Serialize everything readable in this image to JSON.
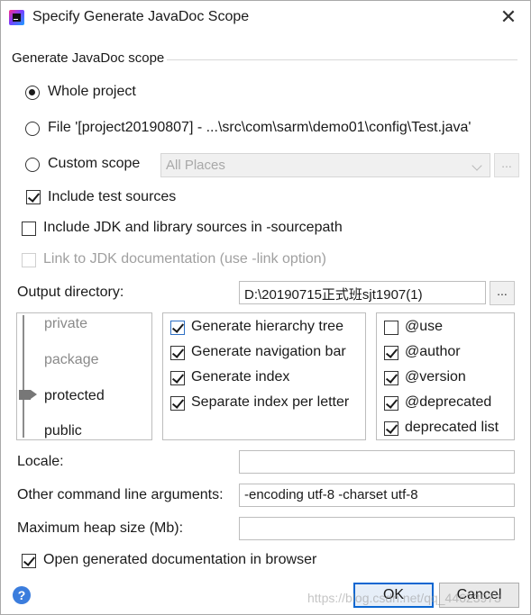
{
  "window": {
    "title": "Specify Generate JavaDoc Scope",
    "close_glyph": "✕"
  },
  "scope": {
    "section_label": "Generate JavaDoc scope",
    "whole_project_label": "Whole project",
    "file_label": "File '[project20190807] - ...\\src\\com\\sarm\\demo01\\config\\Test.java'",
    "custom_scope_label": "Custom scope",
    "custom_scope_value": "All Places",
    "custom_scope_dots": "...",
    "include_test_sources_label": "Include test sources",
    "selected": "whole_project"
  },
  "options": {
    "include_jdk_label": "Include JDK and library sources in -sourcepath",
    "link_jdk_label": "Link to JDK documentation (use -link option)"
  },
  "output": {
    "label": "Output directory:",
    "value": "D:\\20190715正式班sjt1907(1)",
    "browse_label": "..."
  },
  "visibility": {
    "levels": [
      "private",
      "package",
      "protected",
      "public"
    ],
    "selected": "protected"
  },
  "generate": {
    "items": [
      {
        "label": "Generate hierarchy tree",
        "checked": true
      },
      {
        "label": "Generate navigation bar",
        "checked": true
      },
      {
        "label": "Generate index",
        "checked": true
      },
      {
        "label": "Separate index per letter",
        "checked": true
      }
    ]
  },
  "tags": {
    "items": [
      {
        "label": "@use",
        "checked": false
      },
      {
        "label": "@author",
        "checked": true
      },
      {
        "label": "@version",
        "checked": true
      },
      {
        "label": "@deprecated",
        "checked": true
      },
      {
        "label": "deprecated list",
        "checked": true
      }
    ]
  },
  "fields": {
    "locale_label": "Locale:",
    "locale_value": "",
    "args_label": "Other command line arguments:",
    "args_value": "-encoding utf-8 -charset utf-8",
    "heap_label": "Maximum heap size (Mb):",
    "heap_value": ""
  },
  "open_in_browser_label": "Open generated documentation in browser",
  "footer": {
    "help_glyph": "?",
    "ok_label": "OK",
    "cancel_label": "Cancel",
    "watermark": "https://blog.csdn.net/qq_44623973"
  },
  "colors": {
    "accent": "#0a66d1",
    "help": "#3b7ddd"
  }
}
